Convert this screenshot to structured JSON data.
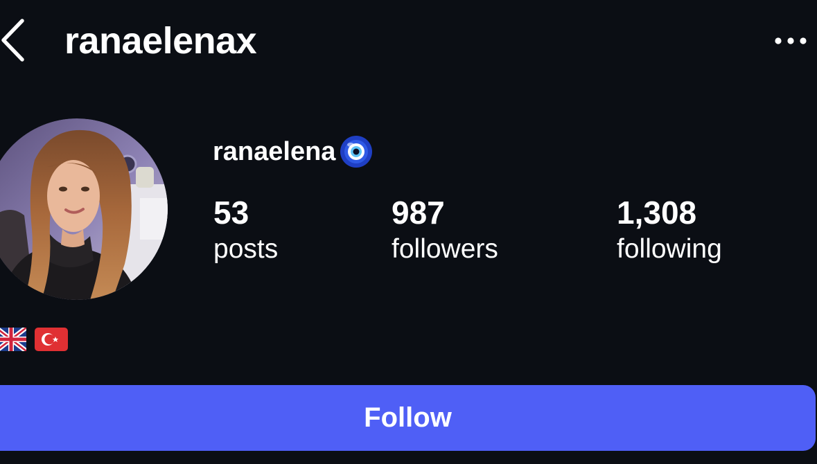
{
  "header": {
    "username": "ranaelenax",
    "back_icon": "chevron-left-icon",
    "more_icon": "ellipsis-icon"
  },
  "profile": {
    "display_name": "ranaelena",
    "name_emoji": "nazar-evil-eye-icon",
    "avatar_icon": "profile-photo"
  },
  "stats": [
    {
      "value": "53",
      "label": "posts"
    },
    {
      "value": "987",
      "label": "followers"
    },
    {
      "value": "1,308",
      "label": "following"
    }
  ],
  "bio": {
    "flags": [
      "uk-flag-icon",
      "turkey-flag-icon"
    ]
  },
  "actions": {
    "follow_label": "Follow"
  },
  "colors": {
    "background": "#0b0e14",
    "text": "#ffffff",
    "follow_button": "#4f5ff6"
  }
}
